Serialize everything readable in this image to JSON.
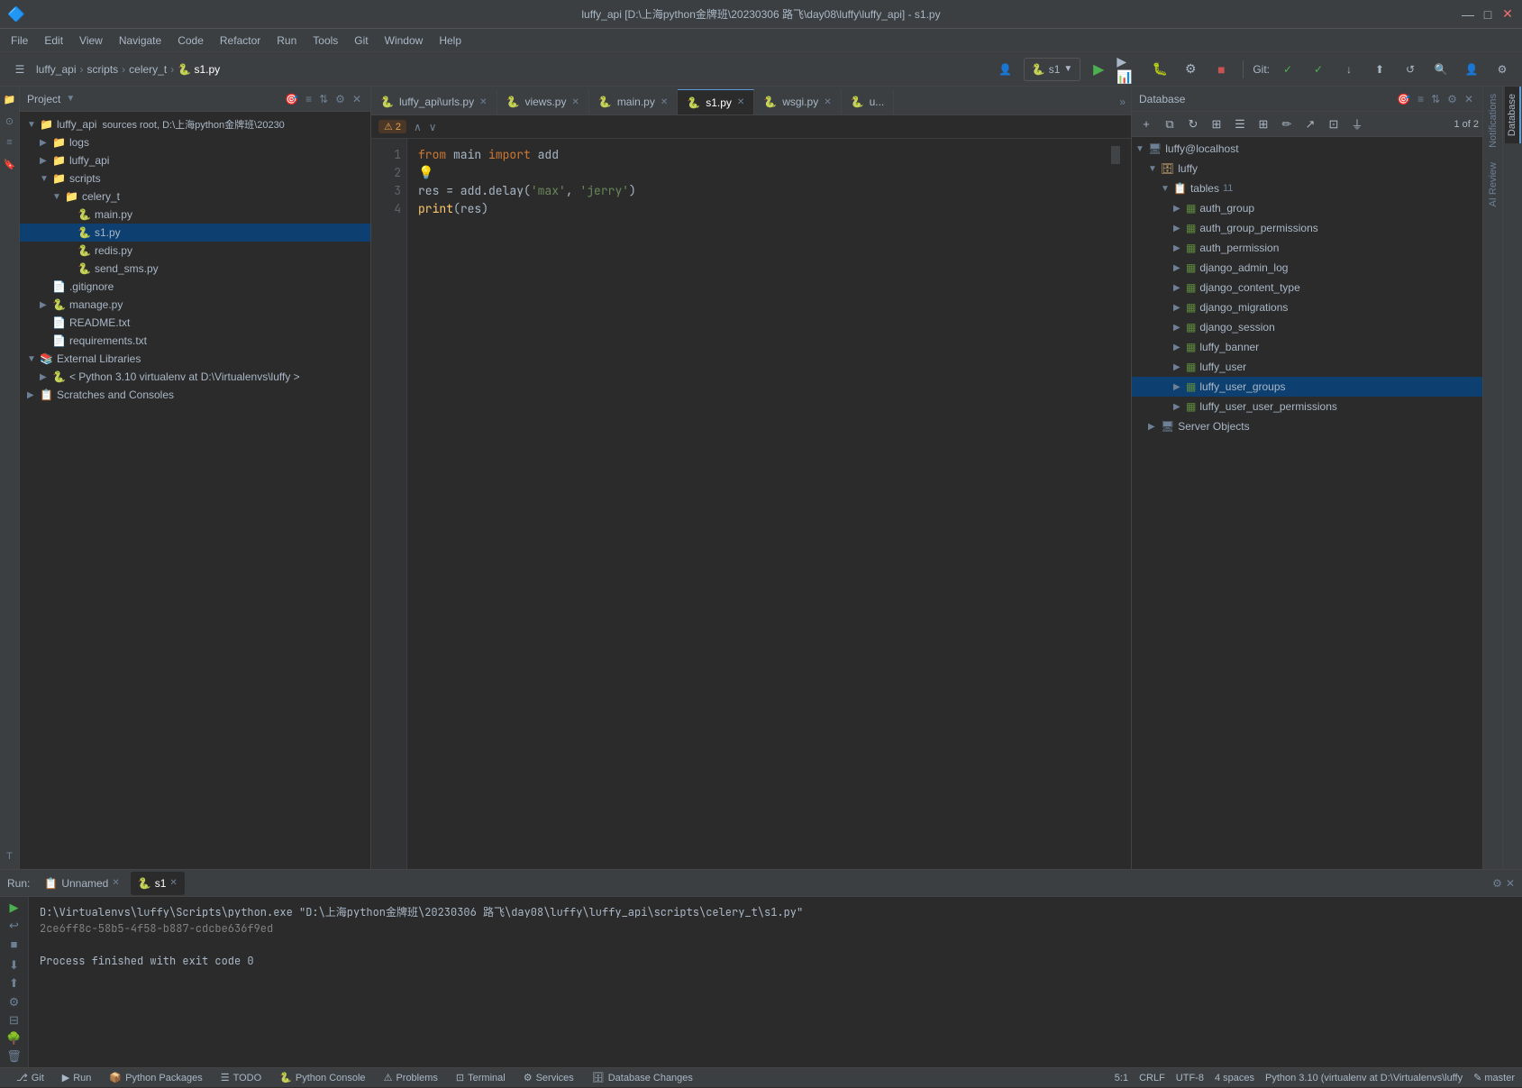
{
  "titlebar": {
    "title": "luffy_api [D:\\上海python金牌班\\20230306 路飞\\day08\\luffy\\luffy_api] - s1.py",
    "logo": "🔷",
    "min_btn": "—",
    "max_btn": "□",
    "close_btn": "✕"
  },
  "menubar": {
    "items": [
      "File",
      "Edit",
      "View",
      "Navigate",
      "Code",
      "Refactor",
      "Run",
      "Tools",
      "Git",
      "Window",
      "Help"
    ]
  },
  "toolbar": {
    "breadcrumb": [
      "luffy_api",
      ">",
      "scripts",
      ">",
      "celery_t",
      ">",
      "s1.py"
    ],
    "run_config": "s1",
    "git_label": "Git:"
  },
  "project_panel": {
    "title": "Project",
    "root": {
      "name": "luffy_api",
      "subtitle": "sources root, D:\\上海python金牌班\\20230",
      "children": [
        {
          "type": "folder",
          "name": "logs",
          "indent": 1
        },
        {
          "type": "folder",
          "name": "luffy_api",
          "indent": 1
        },
        {
          "type": "folder",
          "name": "scripts",
          "expanded": true,
          "indent": 1,
          "children": [
            {
              "type": "folder",
              "name": "celery_t",
              "expanded": true,
              "indent": 2,
              "children": [
                {
                  "type": "py",
                  "name": "main.py",
                  "indent": 3
                },
                {
                  "type": "py",
                  "name": "s1.py",
                  "indent": 3,
                  "selected": true
                },
                {
                  "type": "py",
                  "name": "redis.py",
                  "indent": 3
                },
                {
                  "type": "py",
                  "name": "send_sms.py",
                  "indent": 3
                }
              ]
            }
          ]
        },
        {
          "type": "file",
          "name": ".gitignore",
          "indent": 1
        },
        {
          "type": "py",
          "name": "manage.py",
          "indent": 1
        },
        {
          "type": "file",
          "name": "README.txt",
          "indent": 1
        },
        {
          "type": "file",
          "name": "requirements.txt",
          "indent": 1
        }
      ]
    },
    "external_libraries": {
      "name": "External Libraries",
      "children": [
        {
          "name": "< Python 3.10 virtualenv at D:\\Virtualenvs\\luffy >"
        }
      ]
    },
    "scratches": {
      "name": "Scratches and Consoles"
    }
  },
  "editor": {
    "tabs": [
      {
        "name": "luffy_api\\urls.py",
        "active": false
      },
      {
        "name": "views.py",
        "active": false
      },
      {
        "name": "main.py",
        "active": false
      },
      {
        "name": "s1.py",
        "active": true
      },
      {
        "name": "wsgi.py",
        "active": false
      },
      {
        "name": "u...",
        "active": false
      }
    ],
    "warnings": {
      "count": "2",
      "nav_up": "∧",
      "nav_down": "∨"
    },
    "lines": [
      {
        "num": 1,
        "content": "from main import add",
        "tokens": [
          {
            "text": "from ",
            "class": "kw"
          },
          {
            "text": "main ",
            "class": ""
          },
          {
            "text": "import ",
            "class": "kw"
          },
          {
            "text": "add",
            "class": ""
          }
        ]
      },
      {
        "num": 2,
        "content": "  💡",
        "is_bulb": true
      },
      {
        "num": 3,
        "content": "res = add.delay('max', 'jerry')",
        "tokens": [
          {
            "text": "res = add.delay(",
            "class": ""
          },
          {
            "text": "'max'",
            "class": "str"
          },
          {
            "text": ", ",
            "class": ""
          },
          {
            "text": "'jerry'",
            "class": "str"
          },
          {
            "text": ")",
            "class": ""
          }
        ]
      },
      {
        "num": 4,
        "content": "print(res)",
        "tokens": [
          {
            "text": "print",
            "class": "fn"
          },
          {
            "text": "(res)",
            "class": ""
          }
        ]
      }
    ]
  },
  "database_panel": {
    "title": "Database",
    "page_info": "1 of 2",
    "connection": {
      "name": "luffy@localhost",
      "db": "luffy",
      "tables_count": "11",
      "tables": [
        "auth_group",
        "auth_group_permissions",
        "auth_permission",
        "django_admin_log",
        "django_content_type",
        "django_migrations",
        "django_session",
        "luffy_banner",
        "luffy_user",
        "luffy_user_groups",
        "luffy_user_user_permissions"
      ],
      "tables_highlighted": "luffy_user_groups",
      "server_objects": "Server Objects"
    }
  },
  "bottom_panel": {
    "run_tab": "Run:",
    "tabs": [
      {
        "name": "Unnamed",
        "active": false
      },
      {
        "name": "s1",
        "active": true
      }
    ],
    "console_output": [
      "D:\\Virtualenvs\\luffy\\Scripts\\python.exe \"D:\\上海python金牌班\\20230306 路飞\\day08\\luffy\\luffy_api\\scripts\\celery_t\\s1.py\"",
      "2ce6ff8c-58b5-4f58-b887-cdcbe636f9ed",
      "",
      "Process finished with exit code 0"
    ]
  },
  "statusbar": {
    "tabs": [
      {
        "icon": "⎇",
        "name": "Git"
      },
      {
        "icon": "▶",
        "name": "Run"
      },
      {
        "icon": "📦",
        "name": "Python Packages"
      },
      {
        "icon": "☰",
        "name": "TODO"
      },
      {
        "icon": "🐍",
        "name": "Python Console"
      },
      {
        "icon": "⚠",
        "name": "Problems"
      },
      {
        "icon": "⊡",
        "name": "Terminal"
      },
      {
        "icon": "⚙",
        "name": "Services"
      },
      {
        "icon": "🗄",
        "name": "Database Changes"
      }
    ],
    "right": {
      "position": "5:1",
      "line_separator": "CRLF",
      "encoding": "UTF-8",
      "indent": "4 spaces",
      "python_version": "Python 3.10 (virtualenv at D:\\Virtualenvs\\luffy",
      "branch": "✎ master"
    }
  }
}
